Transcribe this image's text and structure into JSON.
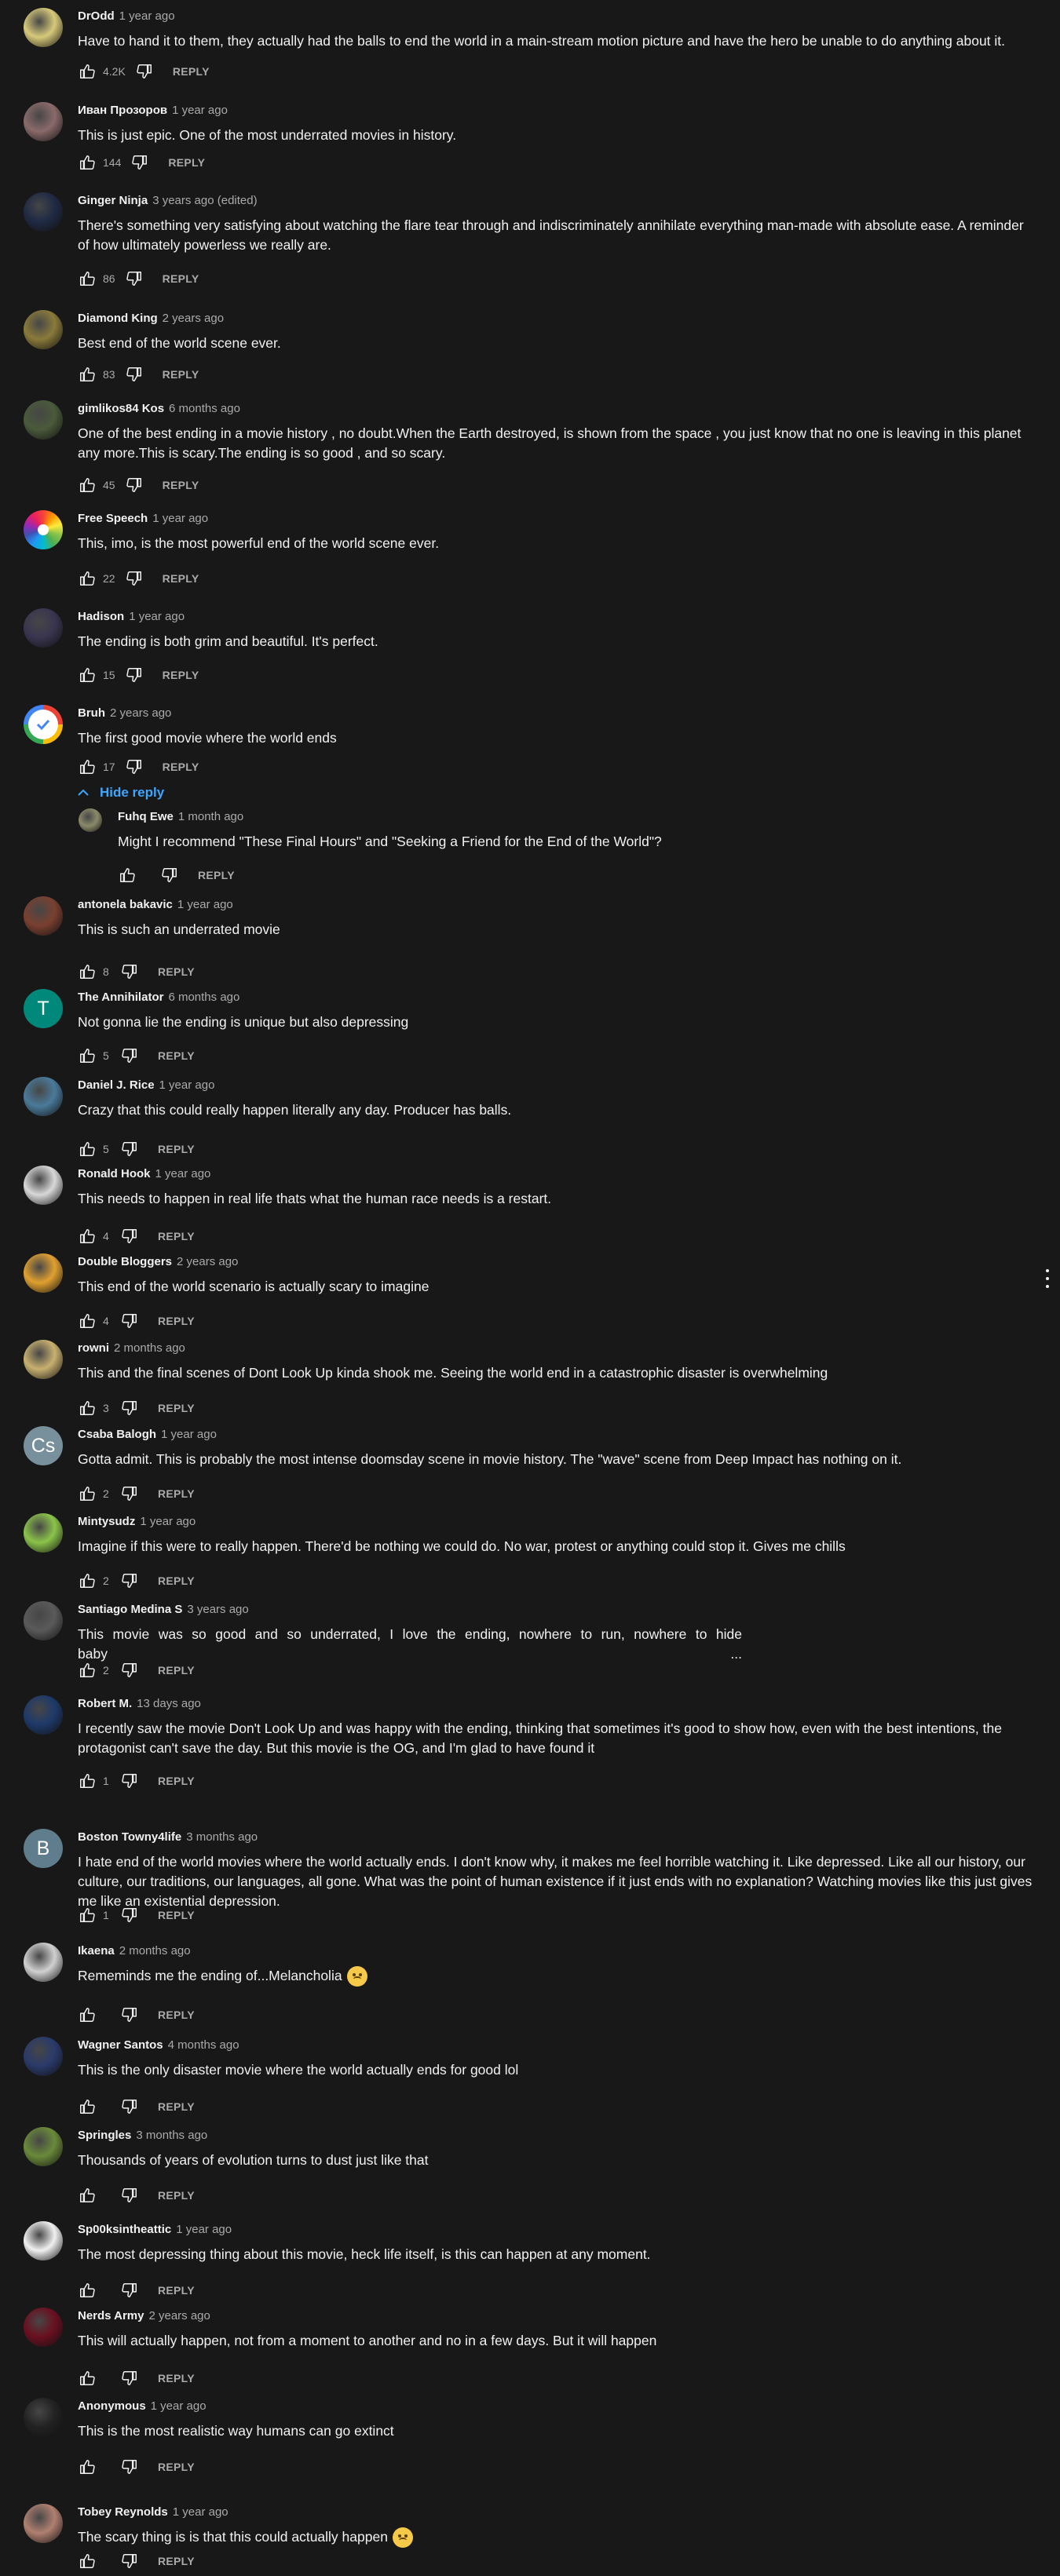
{
  "ui": {
    "reply_label": "REPLY",
    "hide_reply_label": "Hide reply"
  },
  "colors": {
    "background": "#181818",
    "text": "#f1f1f1",
    "muted": "#aaaaaa",
    "link": "#3ea6ff"
  },
  "comments": [
    {
      "author": "DrOdd",
      "time": "1 year ago",
      "text": "Have to hand it to them, they actually had the balls to end the world in a main-stream motion picture and have the hero be unable to do anything about it.",
      "likes": "4.2K",
      "avatar": {
        "style": "image",
        "color": "#d7c97a"
      }
    },
    {
      "author": "Иван Прозоров",
      "time": "1 year ago",
      "text": "This is just epic. One of the most underrated movies in history.",
      "likes": "144",
      "avatar": {
        "style": "image",
        "color": "#8a6a6a"
      }
    },
    {
      "author": "Ginger Ninja",
      "time": "3 years ago (edited)",
      "text": "There's something very satisfying about watching the flare tear through and indiscriminately annihilate everything man-made with absolute ease. A reminder of how ultimately powerless we really are.",
      "likes": "86",
      "avatar": {
        "style": "image",
        "color": "#1f2a44"
      }
    },
    {
      "author": "Diamond King",
      "time": "2 years ago",
      "text": "Best end of the world scene ever.",
      "likes": "83",
      "avatar": {
        "style": "image",
        "color": "#8a7a3a"
      }
    },
    {
      "author": "gimlikos84 Kos",
      "time": "6 months ago",
      "text": "One of the best ending in a movie history , no doubt.When the Earth destroyed, is shown from the space , you just know that no one is leaving in this planet any more.This is scary.The ending is so good , and so scary.",
      "likes": "45",
      "avatar": {
        "style": "image",
        "color": "#4a5a3a"
      }
    },
    {
      "author": "Free Speech",
      "time": "1 year ago",
      "text": "This, imo, is the most powerful end of the world scene ever.",
      "likes": "22",
      "avatar": {
        "style": "color-wheel",
        "color": "#ffffff"
      }
    },
    {
      "author": "Hadison",
      "time": "1 year ago",
      "text": "The ending is both grim and beautiful. It's perfect.",
      "likes": "15",
      "avatar": {
        "style": "image",
        "color": "#3a3550"
      }
    },
    {
      "author": "Bruh",
      "time": "2 years ago",
      "text": "The first good movie where the world ends",
      "likes": "17",
      "avatar": {
        "style": "check",
        "color": "#ffffff"
      }
    },
    {
      "author": "antonela bakavic",
      "time": "1 year ago",
      "text": "This is such an underrated movie",
      "likes": "8",
      "avatar": {
        "style": "image",
        "color": "#7a4030"
      }
    },
    {
      "author": "The Annihilator",
      "time": "6 months ago",
      "text": "Not gonna lie the ending is unique but also depressing",
      "likes": "5",
      "avatar": {
        "style": "letter",
        "letter": "T",
        "color": "#00897b"
      }
    },
    {
      "author": "Daniel J. Rice",
      "time": "1 year ago",
      "text": "Crazy that this could really happen literally any day. Producer has balls.",
      "likes": "5",
      "avatar": {
        "style": "image",
        "color": "#4a7a9a"
      }
    },
    {
      "author": "Ronald Hook",
      "time": "1 year ago",
      "text": "This needs to happen in real life thats what the human race needs is a restart.",
      "likes": "4",
      "avatar": {
        "style": "image",
        "color": "#d8d8d8"
      }
    },
    {
      "author": "Double Bloggers",
      "time": "2 years ago",
      "text": "This end of the world scenario is actually scary to imagine",
      "likes": "4",
      "avatar": {
        "style": "image",
        "color": "#e0a030"
      }
    },
    {
      "author": "rowni",
      "time": "2 months ago",
      "text": "This and the final scenes of Dont Look Up kinda shook me. Seeing the world end in a catastrophic disaster is overwhelming",
      "likes": "3",
      "avatar": {
        "style": "image",
        "color": "#c8b070"
      }
    },
    {
      "author": "Csaba Balogh",
      "time": "1 year ago",
      "text": "Gotta admit. This is probably the most intense doomsday scene in movie history. The \"wave\" scene from Deep Impact has nothing on it.",
      "likes": "2",
      "avatar": {
        "style": "letter",
        "letter": "Cs",
        "color": "#78909c"
      }
    },
    {
      "author": "Mintysudz",
      "time": "1 year ago",
      "text": "Imagine if this were to really happen. There'd be nothing we could do. No war, protest or anything could stop it. Gives me chills",
      "likes": "2",
      "avatar": {
        "style": "image",
        "color": "#8bc34a"
      }
    },
    {
      "author": "Santiago Medina S",
      "time": "3 years ago",
      "text": "This movie was so good and so underrated, I love the ending, nowhere to run, nowhere to hide baby ...",
      "likes": "2",
      "avatar": {
        "style": "image",
        "color": "#5a5a5a"
      }
    },
    {
      "author": "Robert M.",
      "time": "13 days ago",
      "text": "I recently saw the movie Don't Look Up and was happy with the ending, thinking that sometimes it's good to show how, even with the best intentions, the protagonist can't save the day. But this movie is the OG, and I'm glad to have found it",
      "likes": "1",
      "avatar": {
        "style": "image",
        "color": "#1e3a6a"
      }
    },
    {
      "author": "Boston Towny4life",
      "time": "3 months ago",
      "text": "I hate end of the world movies where the world actually ends. I don't know why, it makes me feel horrible watching it. Like depressed. Like all our history, our culture, our traditions, our languages, all gone. What was the point of human existence if it just ends with no explanation? Watching movies like this just gives me like an existential depression.",
      "likes": "1",
      "avatar": {
        "style": "letter",
        "letter": "B",
        "color": "#5f7d8c"
      }
    },
    {
      "author": "Ikaena",
      "time": "2 months ago",
      "text": "Rememinds me the ending of...Melancholia",
      "likes": "",
      "avatar": {
        "style": "image",
        "color": "#d0d0d0"
      },
      "emoji": "pensive-face"
    },
    {
      "author": "Wagner Santos",
      "time": "4 months ago",
      "text": "This is the only disaster movie where the world actually ends for good lol",
      "likes": "",
      "avatar": {
        "style": "image",
        "color": "#2a3a6a"
      }
    },
    {
      "author": "Springles",
      "time": "3 months ago",
      "text": "Thousands of years of evolution turns to dust just like that",
      "likes": "",
      "avatar": {
        "style": "image",
        "color": "#6a8a3a"
      }
    },
    {
      "author": "Sp00ksintheattic",
      "time": "1 year ago",
      "text": "The most depressing thing about this movie, heck life itself, is this can happen at any moment.",
      "likes": "",
      "avatar": {
        "style": "image",
        "color": "#f0f0f0"
      }
    },
    {
      "author": "Nerds Army",
      "time": "2 years ago",
      "text": "This will actually happen, not from a moment to another and no in a few days. But it will happen",
      "likes": "",
      "avatar": {
        "style": "image",
        "color": "#6a1020"
      }
    },
    {
      "author": "Anonymous",
      "time": "1 year ago",
      "text": "This is the most realistic way humans can go extinct",
      "likes": "",
      "avatar": {
        "style": "image",
        "color": "#222222"
      }
    },
    {
      "author": "Tobey Reynolds",
      "time": "1 year ago",
      "text": "The scary thing is is that this could actually happen",
      "likes": "",
      "avatar": {
        "style": "image",
        "color": "#b08070"
      },
      "emoji": "worried-face"
    }
  ],
  "reply": {
    "author": "Fuhq Ewe",
    "time": "1 month ago",
    "text": "Might I recommend \"These Final Hours\" and \"Seeking a Friend for the End of the World\"?",
    "likes": "",
    "avatar": {
      "style": "image",
      "color": "#8a8a6a"
    }
  }
}
